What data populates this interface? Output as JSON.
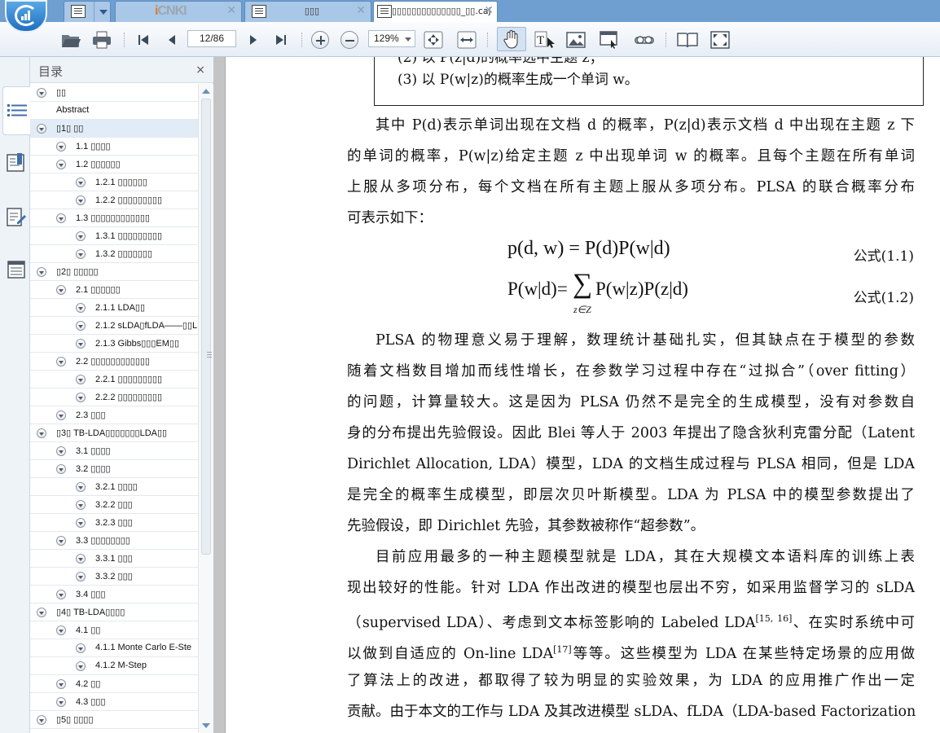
{
  "tabs": {
    "home_icon": "home-doc-icon",
    "cnki": {
      "logo_left": "i",
      "logo_right": "CNKI"
    },
    "doc2": {
      "title": "▯▯▯"
    },
    "active": {
      "title": "▯▯▯▯▯▯▯▯▯▯▯▯▯▯_▯▯.caj"
    }
  },
  "toolbar": {
    "page_value": "12/86",
    "zoom_value": "129%"
  },
  "toc": {
    "title": "目录",
    "close": "×",
    "items": [
      {
        "level": 0,
        "label": "▯▯"
      },
      {
        "level": 0,
        "label": "Abstract",
        "noexp": true
      },
      {
        "level": 0,
        "label": "▯1▯ ▯▯",
        "selected": true
      },
      {
        "level": 1,
        "label": "1.1 ▯▯▯▯"
      },
      {
        "level": 1,
        "label": "1.2 ▯▯▯▯▯▯"
      },
      {
        "level": 2,
        "label": "1.2.1 ▯▯▯▯▯▯"
      },
      {
        "level": 2,
        "label": "1.2.2 ▯▯▯▯▯▯▯▯▯"
      },
      {
        "level": 1,
        "label": "1.3 ▯▯▯▯▯▯▯▯▯▯▯▯"
      },
      {
        "level": 2,
        "label": "1.3.1 ▯▯▯▯▯▯▯▯▯"
      },
      {
        "level": 2,
        "label": "1.3.2 ▯▯▯▯▯▯▯"
      },
      {
        "level": 0,
        "label": "▯2▯ ▯▯▯▯▯"
      },
      {
        "level": 1,
        "label": "2.1 ▯▯▯▯▯▯"
      },
      {
        "level": 2,
        "label": "2.1.1 LDA▯▯"
      },
      {
        "level": 2,
        "label": "2.1.2 sLDA▯fLDA——▯▯L"
      },
      {
        "level": 2,
        "label": "2.1.3 Gibbs▯▯▯EM▯▯"
      },
      {
        "level": 1,
        "label": "2.2 ▯▯▯▯▯▯▯▯▯▯▯▯"
      },
      {
        "level": 2,
        "label": "2.2.1 ▯▯▯▯▯▯▯▯▯"
      },
      {
        "level": 2,
        "label": "2.2.2 ▯▯▯▯▯▯▯▯▯"
      },
      {
        "level": 1,
        "label": "2.3 ▯▯▯"
      },
      {
        "level": 0,
        "label": "▯3▯ TB-LDA▯▯▯▯▯▯▯LDA▯▯"
      },
      {
        "level": 1,
        "label": "3.1 ▯▯▯▯"
      },
      {
        "level": 1,
        "label": "3.2 ▯▯▯▯"
      },
      {
        "level": 2,
        "label": "3.2.1 ▯▯▯▯"
      },
      {
        "level": 2,
        "label": "3.2.2 ▯▯▯"
      },
      {
        "level": 2,
        "label": "3.2.3 ▯▯▯"
      },
      {
        "level": 1,
        "label": "3.3 ▯▯▯▯▯▯▯▯"
      },
      {
        "level": 2,
        "label": "3.3.1 ▯▯▯"
      },
      {
        "level": 2,
        "label": "3.3.2 ▯▯▯"
      },
      {
        "level": 1,
        "label": "3.4 ▯▯▯"
      },
      {
        "level": 0,
        "label": "▯4▯ TB-LDA▯▯▯▯"
      },
      {
        "level": 1,
        "label": "4.1 ▯▯"
      },
      {
        "level": 2,
        "label": "4.1.1 Monte Carlo E-Ste"
      },
      {
        "level": 2,
        "label": "4.1.2 M-Step"
      },
      {
        "level": 1,
        "label": "4.2 ▯▯"
      },
      {
        "level": 1,
        "label": "4.3 ▯▯▯"
      },
      {
        "level": 0,
        "label": "▯5▯ ▯▯▯▯"
      }
    ]
  },
  "document": {
    "box_prev_line": "(2) 以 P(z|d)的概率选中主题 z；",
    "box_line": "(3) 以 P(w|z)的概率生成一个单词 w。",
    "para1": [
      "其中 P(d)表示单词出现在文档 d 的概率，P(z|d)表示文档 d 中出现在主题 z 下",
      "的单词的概率，P(w|z)给定主题 z 中出现单词 w 的概率。且每个主题在所有单词",
      "上服从多项分布，每个文档在所有主题上服从多项分布。PLSA 的联合概率分布",
      "可表示如下："
    ],
    "eq1": "p(d, w) = P(d)P(w|d)",
    "eq1_label": "公式(1.1)",
    "eq2_left": "P(w|d)=",
    "eq2_sum": "∑",
    "eq2_sub": "z∈Z",
    "eq2_right": "P(w|z)P(z|d)",
    "eq2_label": "公式(1.2)",
    "para2": [
      "PLSA 的物理意义易于理解，数理统计基础扎实，但其缺点在于模型的参数",
      "随着文档数目增加而线性增长，在参数学习过程中存在“过拟合”（over fitting）",
      "的问题，计算量较大。这是因为 PLSA 仍然不是完全的生成模型，没有对参数自",
      "身的分布提出先验假设。因此 Blei 等人于 2003 年提出了隐含狄利克雷分配（Latent",
      "Dirichlet Allocation, LDA）模型，LDA 的文档生成过程与 PLSA 相同，但是 LDA",
      "是完全的概率生成模型，即层次贝叶斯模型。LDA 为 PLSA 中的模型参数提出了",
      "先验假设，即 Dirichlet 先验，其参数被称作“超参数”。"
    ],
    "para3": [
      "目前应用最多的一种主题模型就是 LDA，其在大规模文本语料库的训练上表",
      "现出较好的性能。针对 LDA 作出改进的模型也层出不穷，如采用监督学习的 sLDA",
      "（supervised LDA）、考虑到文本标签影响的 Labeled LDA",
      "以做到自适应的 On-line LDA",
      "了算法上的改进，都取得了较为明显的实验效果，为 LDA 的应用推广作出一定",
      "贡献。由于本文的工作与 LDA 及其改进模型 sLDA、fLDA（LDA-based Factorization"
    ],
    "ref1": "[15, 16]",
    "ref1_after": "、在实时系统中可",
    "ref2": "[17]",
    "ref2_after": "等等。这些模型为 LDA 在某些特定场景的应用做"
  }
}
